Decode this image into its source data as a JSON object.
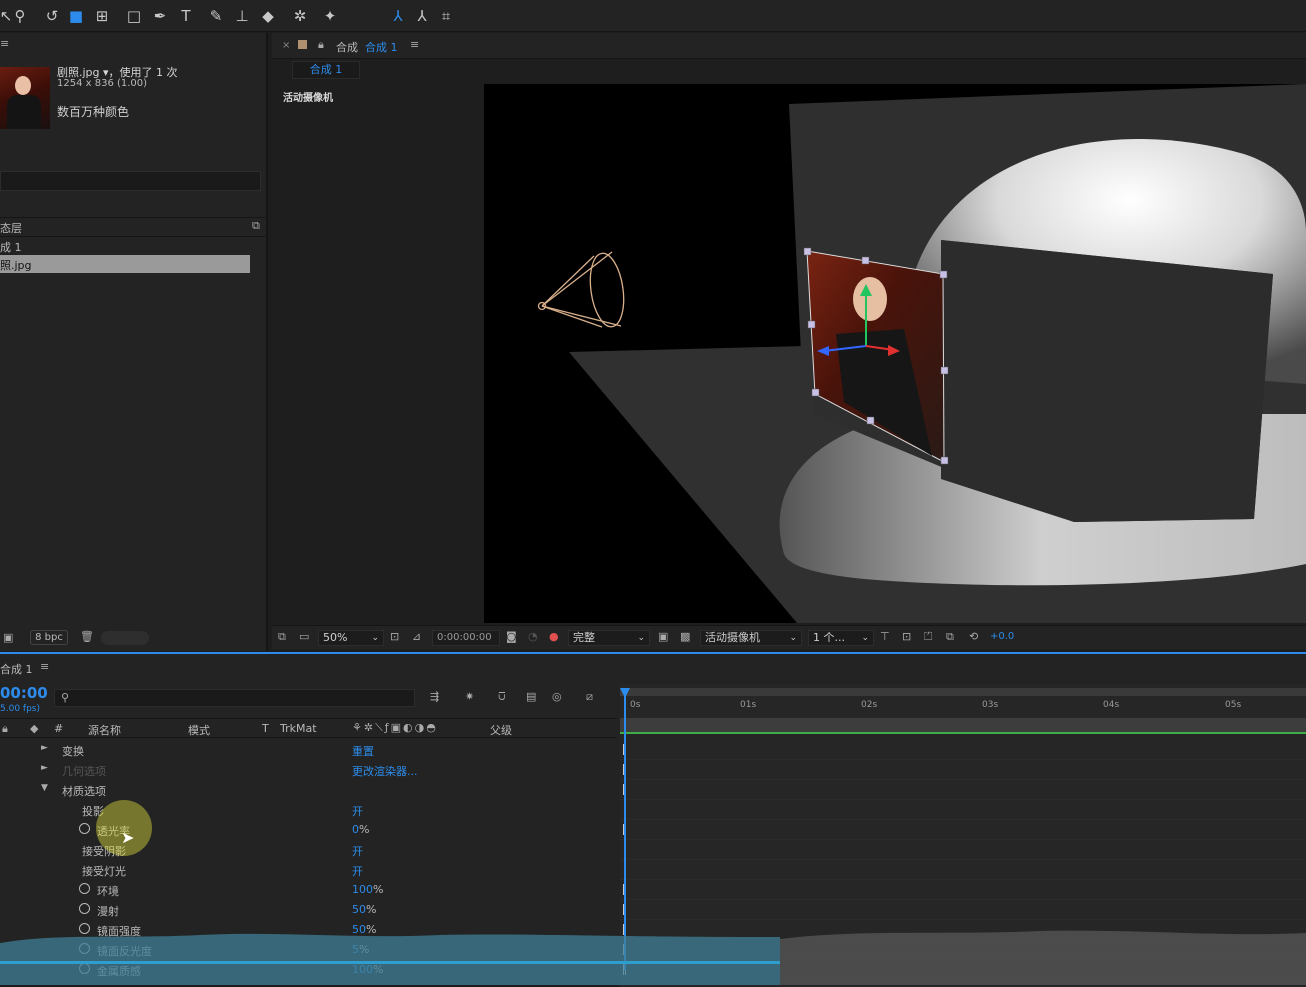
{
  "toolbar": {
    "icons": [
      "select-icon",
      "zoom-icon",
      "rotate-icon",
      "camera-icon",
      "pan-behind-icon",
      "rectangle-icon",
      "pen-icon",
      "text-icon",
      "brush-icon",
      "clone-stamp-icon",
      "eraser-icon",
      "roto-brush-icon",
      "puppet-pin-icon",
      "local-axis-icon",
      "world-axis-icon",
      "view-axis-icon"
    ]
  },
  "project": {
    "file_name": "剧照.jpg ▾，使用了 1 次",
    "dimensions": "1254 x 836 (1.00)",
    "color": "数百万种颜色",
    "header_label": "态层",
    "items": [
      "成 1",
      "照.jpg"
    ],
    "bpc": "8 bpc"
  },
  "viewer": {
    "tab_prefix": "合成",
    "tab_name": "合成 1",
    "subtab": "合成 1",
    "camera_label": "活动摄像机",
    "zoom": "50%",
    "timecode": "0:00:00:00",
    "resolution": "完整",
    "camera_select": "活动摄像机",
    "views": "1 个...",
    "exposure": "+0.0"
  },
  "timeline": {
    "comp_tab": "合成 1",
    "timecode": "00:00",
    "fps": "5.00 fps)",
    "columns": {
      "hash": "#",
      "source": "源名称",
      "mode": "模式",
      "t": "T",
      "trkmat": "TrkMat",
      "parent": "父级"
    },
    "ruler": [
      "0s",
      "01s",
      "02s",
      "03s",
      "04s",
      "05s"
    ],
    "rows": [
      {
        "name": "变换",
        "value": "重置",
        "unit": "",
        "kind": "group",
        "dim": false
      },
      {
        "name": "几何选项",
        "value": "更改渲染器...",
        "unit": "",
        "kind": "group",
        "dim": true
      },
      {
        "name": "材质选项",
        "value": "",
        "unit": "",
        "kind": "open",
        "dim": false
      },
      {
        "name": "投影",
        "value": "开",
        "unit": "",
        "kind": "prop",
        "dim": false
      },
      {
        "name": "透光率",
        "value": "0",
        "unit": "%",
        "kind": "stopwatch",
        "dim": false
      },
      {
        "name": "接受阴影",
        "value": "开",
        "unit": "",
        "kind": "prop",
        "dim": false
      },
      {
        "name": "接受灯光",
        "value": "开",
        "unit": "",
        "kind": "prop",
        "dim": false
      },
      {
        "name": "环境",
        "value": "100",
        "unit": "%",
        "kind": "stopwatch",
        "dim": false
      },
      {
        "name": "漫射",
        "value": "50",
        "unit": "%",
        "kind": "stopwatch",
        "dim": false
      },
      {
        "name": "镜面强度",
        "value": "50",
        "unit": "%",
        "kind": "stopwatch",
        "dim": false
      },
      {
        "name": "镜面反光度",
        "value": "5",
        "unit": "%",
        "kind": "stopwatch",
        "dim": false
      },
      {
        "name": "金属质感",
        "value": "100",
        "unit": "%",
        "kind": "stopwatch",
        "dim": false
      }
    ]
  },
  "colors": {
    "accent": "#2d8ceb",
    "panel": "#232323",
    "canvas": "#000000"
  }
}
